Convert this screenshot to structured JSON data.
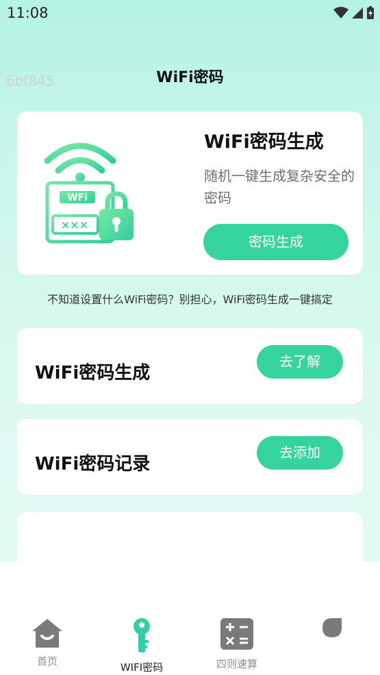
{
  "status_bar": {
    "time": "11:08"
  },
  "watermark": "6bf845",
  "header": {
    "title": "WiFi密码"
  },
  "hero": {
    "title": "WiFi密码生成",
    "description": "随机一键生成复杂安全的密码",
    "button_label": "密码生成",
    "illustration": {
      "badge_text": "WFi",
      "password_mask": "×××"
    }
  },
  "hint": "不知道设置什么WiFi密码？别担心，WiFi密码生成一键搞定",
  "features": [
    {
      "label": "WiFi密码生成",
      "button_label": "去了解"
    },
    {
      "label": "WiFi密码记录",
      "button_label": "去添加"
    }
  ],
  "bottom_nav": {
    "items": [
      {
        "label": "首页",
        "icon": "home-icon",
        "active": false
      },
      {
        "label": "WIFI密码",
        "icon": "key-icon",
        "active": true
      },
      {
        "label": "四则速算",
        "icon": "calculator-icon",
        "active": false
      },
      {
        "label": "",
        "icon": "leaf-icon",
        "active": false
      }
    ]
  },
  "colors": {
    "accent": "#35d49e",
    "background_top": "#b4f2e3",
    "card": "#ffffff",
    "nav_active": "#33cfa6",
    "nav_inactive": "#7a7a7a"
  }
}
